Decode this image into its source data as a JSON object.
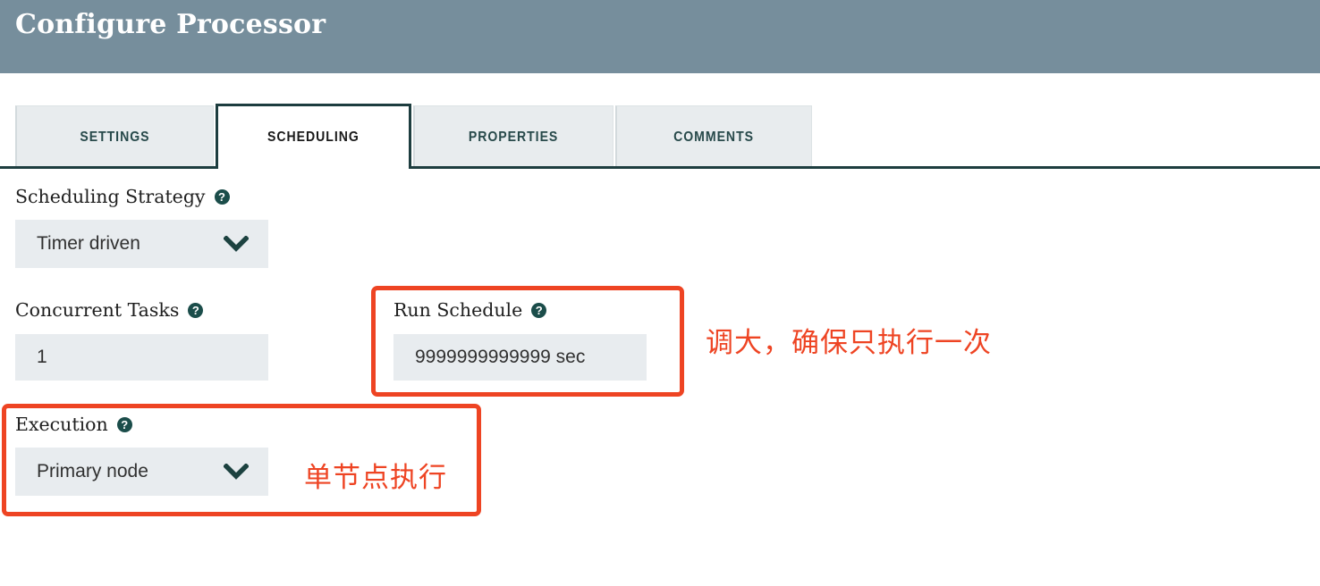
{
  "header": {
    "title": "Configure Processor"
  },
  "tabs": [
    {
      "label": "SETTINGS",
      "active": false
    },
    {
      "label": "SCHEDULING",
      "active": true
    },
    {
      "label": "PROPERTIES",
      "active": false
    },
    {
      "label": "COMMENTS",
      "active": false
    }
  ],
  "help_glyph": "?",
  "fields": {
    "scheduling_strategy": {
      "label": "Scheduling Strategy",
      "value": "Timer driven",
      "control": "select"
    },
    "concurrent_tasks": {
      "label": "Concurrent Tasks",
      "value": "1",
      "control": "text"
    },
    "run_schedule": {
      "label": "Run Schedule",
      "value": "9999999999999 sec",
      "control": "text"
    },
    "execution": {
      "label": "Execution",
      "value": "Primary node",
      "control": "select"
    }
  },
  "annotations": [
    {
      "name": "run-schedule-note",
      "text": "调大，确保只执行一次"
    },
    {
      "name": "execution-note",
      "text": "单节点执行"
    }
  ],
  "colors": {
    "header_bg": "#768E9C",
    "tab_active_border": "#1D3D3F",
    "tab_inactive_bg": "#E8ECEE",
    "tab_text": "#27494A",
    "input_bg": "#E8ECEF",
    "help_icon_bg": "#1B4D4A",
    "chevron": "#1C4240",
    "annotation": "#EE4423"
  }
}
